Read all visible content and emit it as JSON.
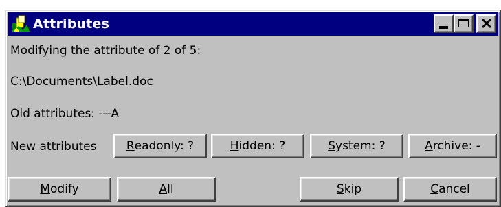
{
  "window": {
    "title": "Attributes",
    "icon": "folder-app-icon",
    "controls": [
      "minimize",
      "maximize",
      "close"
    ]
  },
  "body": {
    "status_line": "Modifying the attribute of 2 of 5:",
    "file_path": "C:\\Documents\\Label.doc",
    "old_attributes": "Old attributes: ---A",
    "new_attributes_label": "New attributes"
  },
  "attribute_buttons": [
    {
      "mnemonic": "R",
      "rest": "eadonly: ?"
    },
    {
      "mnemonic": "H",
      "rest": "idden: ?"
    },
    {
      "mnemonic": "S",
      "rest": "ystem: ?"
    },
    {
      "mnemonic": "A",
      "rest": "rchive: -"
    }
  ],
  "action_buttons": [
    {
      "mnemonic": "M",
      "rest": "odify"
    },
    {
      "mnemonic": "A",
      "rest": "ll"
    },
    {
      "mnemonic": "S",
      "rest": "kip"
    },
    {
      "mnemonic": "C",
      "rest": "ancel"
    }
  ],
  "colors": {
    "titlebar": "#000080",
    "face": "#c0c0c0",
    "title_text": "#ffffff"
  }
}
